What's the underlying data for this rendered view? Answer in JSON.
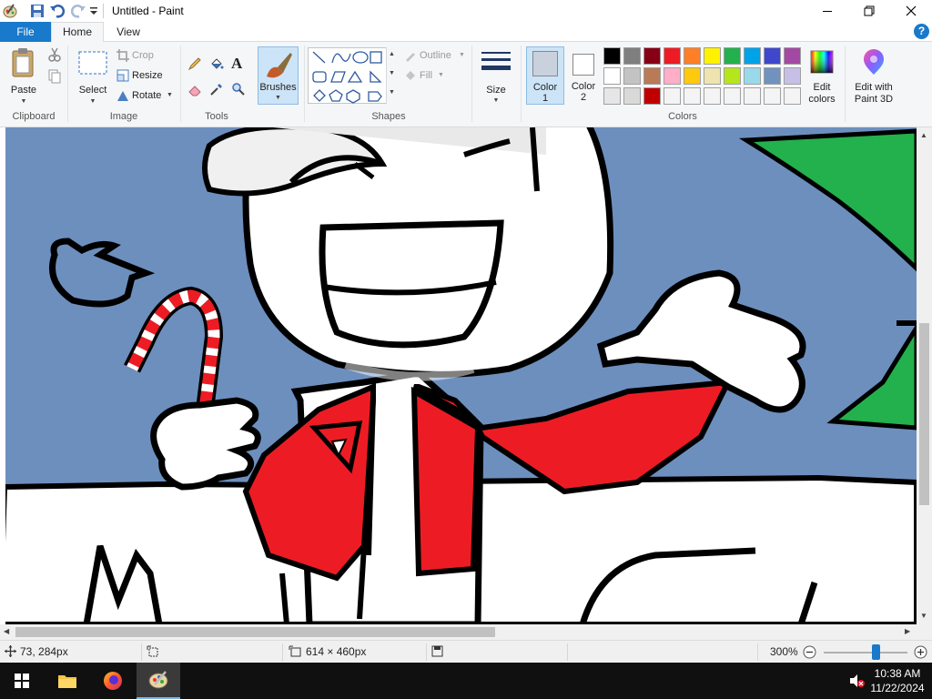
{
  "window": {
    "title": "Untitled - Paint"
  },
  "tabs": {
    "file": "File",
    "home": "Home",
    "view": "View",
    "help": "?"
  },
  "clipboard": {
    "paste": "Paste",
    "group": "Clipboard"
  },
  "image": {
    "select": "Select",
    "crop": "Crop",
    "resize": "Resize",
    "rotate": "Rotate",
    "group": "Image"
  },
  "tools": {
    "group": "Tools",
    "text_tool": "A"
  },
  "brushes": {
    "label": "Brushes"
  },
  "shapes": {
    "outline": "Outline",
    "fill": "Fill",
    "group": "Shapes"
  },
  "size": {
    "label": "Size"
  },
  "colors": {
    "color1_label": "Color",
    "color1_num": "1",
    "color2_label": "Color",
    "color2_num": "2",
    "edit_colors": "Edit colors",
    "edit_paint3d": "Edit with Paint 3D",
    "group": "Colors",
    "color1_value": "#c8d1dc",
    "color2_value": "#ffffff",
    "palette_row1": [
      "#000000",
      "#7f7f7f",
      "#880015",
      "#ed1c24",
      "#ff7f27",
      "#fff200",
      "#22b14c",
      "#00a2e8",
      "#3f48cc",
      "#a349a4"
    ],
    "palette_row2": [
      "#ffffff",
      "#c3c3c3",
      "#b97a57",
      "#ffaec9",
      "#ffc90e",
      "#efe4b0",
      "#b5e61d",
      "#99d9ea",
      "#7092be",
      "#c8bfe7"
    ],
    "palette_row3": [
      "#e6e6e6",
      "#d9d9d9",
      "#c00000",
      "#f4f4f4",
      "#f4f4f4",
      "#f4f4f4",
      "#f4f4f4",
      "#f4f4f4",
      "#f4f4f4",
      "#f4f4f4"
    ]
  },
  "status": {
    "cursor_pos": "73, 284px",
    "image_size": "614 × 460px",
    "zoom": "300%",
    "zoom_fraction": 0.62
  },
  "taskbar": {
    "time": "10:38 AM",
    "date": "11/22/2024"
  }
}
